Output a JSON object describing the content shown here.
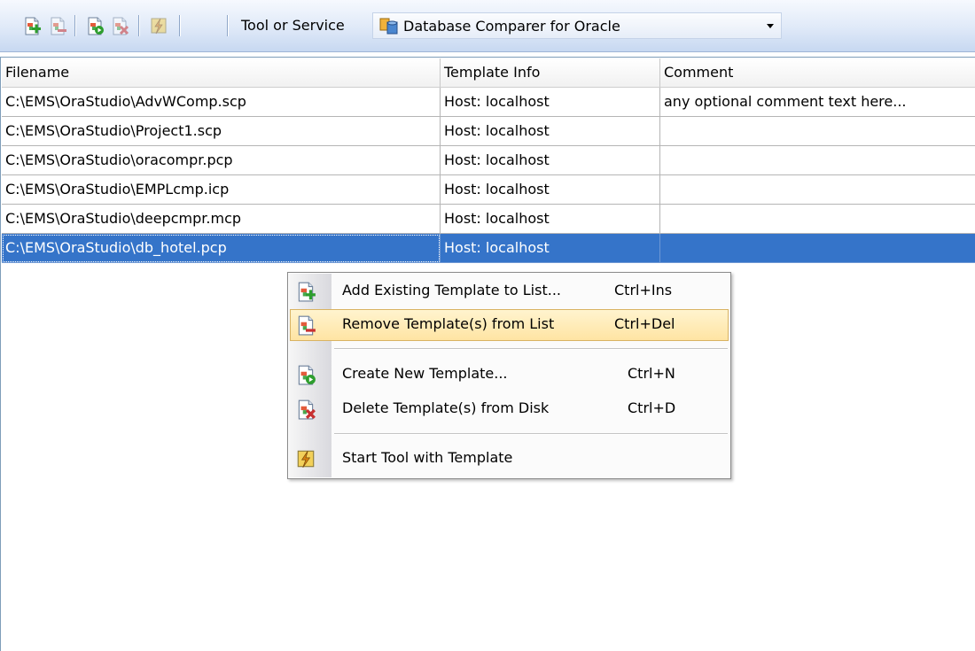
{
  "toolbar": {
    "buttons": [
      {
        "icon": "add-template-icon"
      },
      {
        "icon": "remove-template-icon"
      },
      {
        "icon": "create-template-icon"
      },
      {
        "icon": "delete-template-icon"
      },
      {
        "icon": "start-tool-icon"
      }
    ],
    "tool_label": "Tool or Service",
    "tool_combo": {
      "value": "Database Comparer for Oracle",
      "icon": "db-comparer-icon"
    }
  },
  "grid": {
    "columns": [
      "Filename",
      "Template Info",
      "Comment"
    ],
    "rows": [
      {
        "filename": "C:\\EMS\\OraStudio\\AdvWComp.scp",
        "info": "Host: localhost",
        "comment": "any optional comment text here..."
      },
      {
        "filename": "C:\\EMS\\OraStudio\\Project1.scp",
        "info": "Host: localhost",
        "comment": ""
      },
      {
        "filename": "C:\\EMS\\OraStudio\\oracompr.pcp",
        "info": "Host: localhost",
        "comment": ""
      },
      {
        "filename": "C:\\EMS\\OraStudio\\EMPLcmp.icp",
        "info": "Host: localhost",
        "comment": ""
      },
      {
        "filename": "C:\\EMS\\OraStudio\\deepcmpr.mcp",
        "info": "Host: localhost",
        "comment": ""
      },
      {
        "filename": "C:\\EMS\\OraStudio\\db_hotel.pcp",
        "info": "Host: localhost",
        "comment": ""
      }
    ],
    "selected_row": 5
  },
  "context_menu": {
    "items": [
      {
        "label": "Add Existing Template to List...",
        "shortcut": "Ctrl+Ins",
        "icon": "add-template-icon"
      },
      {
        "label": "Remove Template(s) from List",
        "shortcut": "Ctrl+Del",
        "icon": "remove-template-icon",
        "highlighted": true
      },
      {
        "label": "Create New Template...",
        "shortcut": "Ctrl+N",
        "icon": "create-template-icon"
      },
      {
        "label": "Delete Template(s) from Disk",
        "shortcut": "Ctrl+D",
        "icon": "delete-template-icon"
      },
      {
        "label": "Start Tool with Template",
        "shortcut": "",
        "icon": "start-tool-icon"
      }
    ]
  },
  "colors": {
    "selection": "#3574c9",
    "menu_highlight": "#ffe8a6",
    "toolbar": "#dfe9f8"
  }
}
